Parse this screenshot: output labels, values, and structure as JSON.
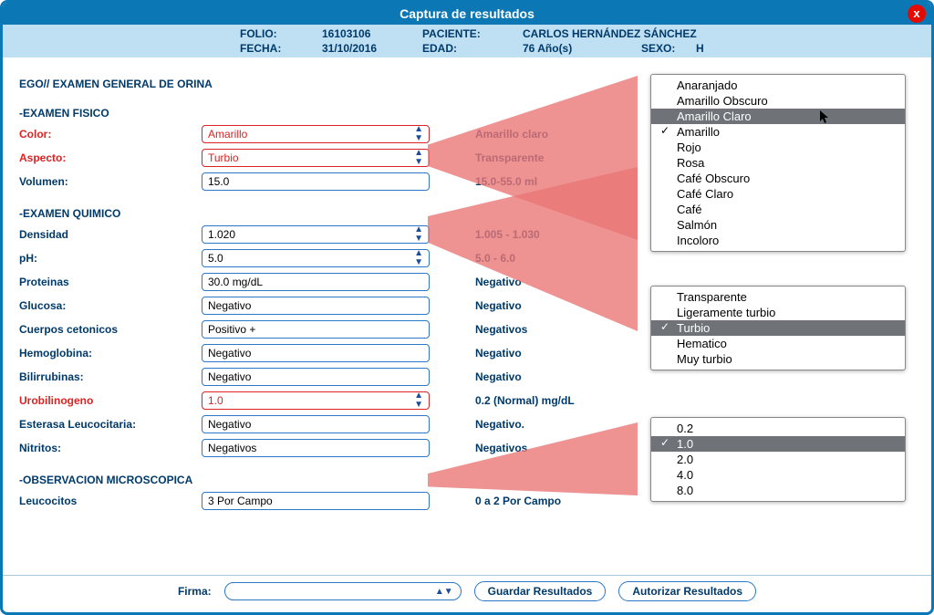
{
  "window": {
    "title": "Captura de resultados"
  },
  "header": {
    "folio_label": "FOLIO:",
    "folio_value": "16103106",
    "paciente_label": "PACIENTE:",
    "paciente_value": "CARLOS HERNÁNDEZ SÁNCHEZ",
    "fecha_label": "FECHA:",
    "fecha_value": "31/10/2016",
    "edad_label": "EDAD:",
    "edad_value": "76 Año(s)",
    "sexo_label": "SEXO:",
    "sexo_value": "H"
  },
  "study_title": "EGO// EXAMEN GENERAL DE ORINA",
  "sections": {
    "fisico_title": "-EXAMEN FISICO",
    "quimico_title": "-EXAMEN QUIMICO",
    "micro_title": "-OBSERVACION MICROSCOPICA"
  },
  "rows": {
    "color": {
      "label": "Color:",
      "value": "Amarillo",
      "ref": "Amarillo claro",
      "abnormal": true,
      "type": "select"
    },
    "aspecto": {
      "label": "Aspecto:",
      "value": "Turbio",
      "ref": "Transparente",
      "abnormal": true,
      "type": "select"
    },
    "volumen": {
      "label": "Volumen:",
      "value": "15.0",
      "ref": "15.0-55.0 ml",
      "abnormal": false,
      "type": "input"
    },
    "densidad": {
      "label": "Densidad",
      "value": "1.020",
      "ref": "1.005 - 1.030",
      "abnormal": false,
      "type": "select"
    },
    "ph": {
      "label": "pH:",
      "value": "5.0",
      "ref": "5.0 - 6.0",
      "abnormal": false,
      "type": "select"
    },
    "proteinas": {
      "label": "Proteinas",
      "value": "30.0 mg/dL",
      "ref": "Negativo",
      "abnormal": false,
      "type": "input"
    },
    "glucosa": {
      "label": "Glucosa:",
      "value": "Negativo",
      "ref": "Negativo",
      "abnormal": false,
      "type": "input"
    },
    "cetonicos": {
      "label": "Cuerpos cetonicos",
      "value": "Positivo +",
      "ref": "Negativos",
      "abnormal": false,
      "type": "input"
    },
    "hemoglobina": {
      "label": "Hemoglobina:",
      "value": "Negativo",
      "ref": "Negativo",
      "abnormal": false,
      "type": "input"
    },
    "bilirrubinas": {
      "label": "Bilirrubinas:",
      "value": "Negativo",
      "ref": "Negativo",
      "abnormal": false,
      "type": "input"
    },
    "urobilinogeno": {
      "label": "Urobilinogeno",
      "value": "1.0",
      "ref": "0.2 (Normal) mg/dL",
      "abnormal": true,
      "type": "select"
    },
    "esterasa": {
      "label": "Esterasa Leucocitaria:",
      "value": "Negativo",
      "ref": "Negativo.",
      "abnormal": false,
      "type": "input"
    },
    "nitritos": {
      "label": "Nitritos:",
      "value": "Negativos",
      "ref": "Negativos",
      "abnormal": false,
      "type": "input"
    },
    "leucocitos": {
      "label": "Leucocitos",
      "value": "3 Por Campo",
      "ref": "0 a 2 Por Campo",
      "abnormal": false,
      "type": "input"
    }
  },
  "footer": {
    "firma_label": "Firma:",
    "firma_value": "",
    "save_label": "Guardar Resultados",
    "auth_label": "Autorizar Resultados"
  },
  "dropdowns": {
    "color": {
      "options": [
        "Anaranjado",
        "Amarillo Obscuro",
        "Amarillo Claro",
        "Amarillo",
        "Rojo",
        "Rosa",
        "Café Obscuro",
        "Café Claro",
        "Café",
        "Salmón",
        "Incoloro"
      ],
      "highlighted": "Amarillo Claro",
      "checked": "Amarillo"
    },
    "aspecto": {
      "options": [
        "Transparente",
        "Ligeramente turbio",
        "Turbio",
        "Hematico",
        "Muy turbio"
      ],
      "highlighted": "Turbio",
      "checked": "Turbio"
    },
    "urobilinogeno": {
      "options": [
        "0.2",
        "1.0",
        "2.0",
        "4.0",
        "8.0"
      ],
      "highlighted": "1.0",
      "checked": "1.0"
    }
  },
  "close_glyph": "x"
}
